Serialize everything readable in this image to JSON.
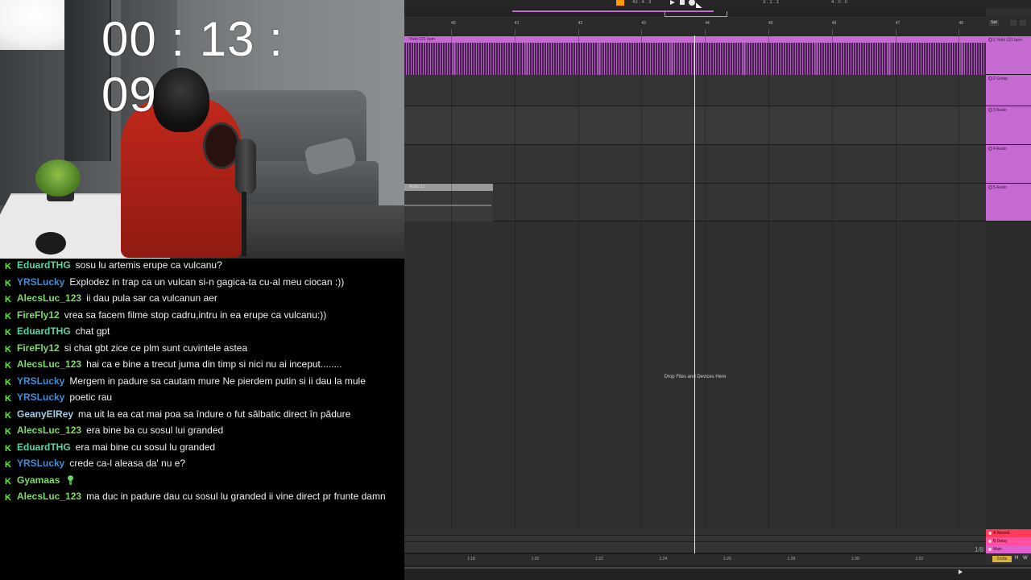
{
  "stream": {
    "timer": "00 : 13 : 09"
  },
  "chat": {
    "messages": [
      {
        "user": "EduardTHG",
        "color": "#55d8a3",
        "text": "sosu lu artemis erupe ca vulcanu?"
      },
      {
        "user": "YRSLucky",
        "color": "#3f8fd8",
        "text": "Explodez in trap ca un vulcan si-n gagica-ta cu-al meu ciocan :))"
      },
      {
        "user": "AlecsLuc_123",
        "color": "#7fd96a",
        "text": "ii dau pula sar ca vulcanun aer"
      },
      {
        "user": "FireFly12",
        "color": "#7fd96a",
        "text": "vrea sa facem filme stop cadru,intru in ea erupe ca vulcanu:))"
      },
      {
        "user": "EduardTHG",
        "color": "#55d8a3",
        "text": "chat gpt"
      },
      {
        "user": "FireFly12",
        "color": "#7fd96a",
        "text": "si chat gbt zice ce plm sunt cuvintele astea"
      },
      {
        "user": "AlecsLuc_123",
        "color": "#7fd96a",
        "text": "hai ca e bine a trecut juma din timp si nici nu ai inceput........"
      },
      {
        "user": "YRSLucky",
        "color": "#3f8fd8",
        "text": "Mergem in padure sa cautam mure Ne pierdem putin si ii dau la mule"
      },
      {
        "user": "YRSLucky",
        "color": "#3f8fd8",
        "text": "poetic rau"
      },
      {
        "user": "GeanyElRey",
        "color": "#9ed0e8",
        "text": "ma uit la ea cat mai poa sa îndure o fut sălbatic direct în pădure"
      },
      {
        "user": "AlecsLuc_123",
        "color": "#7fd96a",
        "text": "era bine ba cu sosul lui granded"
      },
      {
        "user": "EduardTHG",
        "color": "#55d8a3",
        "text": "era mai bine cu sosul lu granded"
      },
      {
        "user": "YRSLucky",
        "color": "#3f8fd8",
        "text": "crede ca-l aleasa da' nu e?"
      },
      {
        "user": "Gyamaas",
        "color": "#7fd96a",
        "text": "",
        "sticker": true
      },
      {
        "user": "AlecsLuc_123",
        "color": "#7fd96a",
        "text": "ma duc in padure dau cu sosul lu granded ii vine direct pr frunte damn"
      }
    ]
  },
  "daw": {
    "transport": {
      "tempo_sig": "43 . 4 . 3",
      "position": "3 . 1 . 1",
      "loop_len": "4 . 0 . 0"
    },
    "ruler": [
      "40",
      "41",
      "42",
      "43",
      "44",
      "45",
      "46",
      "47",
      "48"
    ],
    "tracks": [
      {
        "name": "1 Yield 121 bpm",
        "clip": "Yield 121 bpm",
        "kind": "audio-clip"
      },
      {
        "name": "2 Group",
        "kind": "empty"
      },
      {
        "name": "3 Audio",
        "kind": "empty"
      },
      {
        "name": "4 Audio",
        "kind": "empty"
      },
      {
        "name": "5 Audio",
        "clip": "Audio 11",
        "kind": "small-clip"
      }
    ],
    "returns": [
      {
        "name": "A Reverb",
        "color": "#ff3b5c"
      },
      {
        "name": "B Delay",
        "color": "#ff4fa0"
      },
      {
        "name": "Main",
        "color": "#e060d0"
      }
    ],
    "set_label": "Set",
    "drop_hint": "Drop Files and Devices Here",
    "bottom_ruler": [
      "1:18",
      "1:20",
      "1:22",
      "1:24",
      "1:26",
      "1:28",
      "1:30",
      "1:32"
    ],
    "page_fraction": "1/8",
    "cpu": "0.00s",
    "hw": [
      "H",
      "W"
    ],
    "accent": "#c46ad0"
  }
}
